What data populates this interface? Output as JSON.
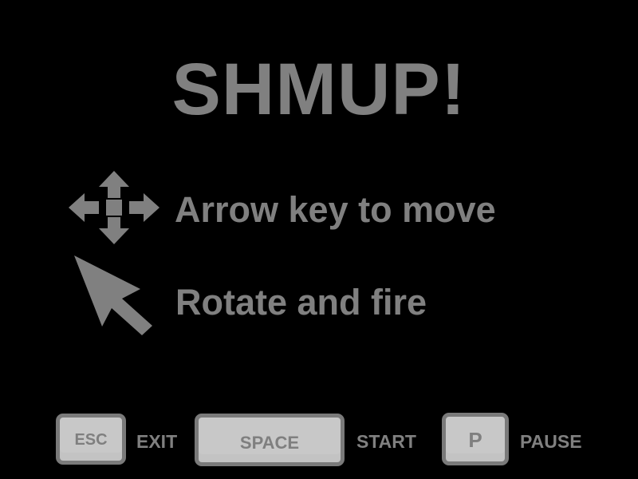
{
  "title": "SHMUP!",
  "instructions": [
    {
      "icon": "move-arrows-icon",
      "text": "Arrow key to move"
    },
    {
      "icon": "mouse-cursor-icon",
      "text": "Rotate and fire"
    }
  ],
  "keys": {
    "exit": {
      "key": "ESC",
      "label": "EXIT"
    },
    "start": {
      "key": "SPACE",
      "label": "START"
    },
    "pause": {
      "key": "P",
      "label": "PAUSE"
    }
  },
  "colors": {
    "background": "#000000",
    "text": "#808080",
    "key_face": "#c8c8c8",
    "key_border": "#7a7a7a"
  }
}
